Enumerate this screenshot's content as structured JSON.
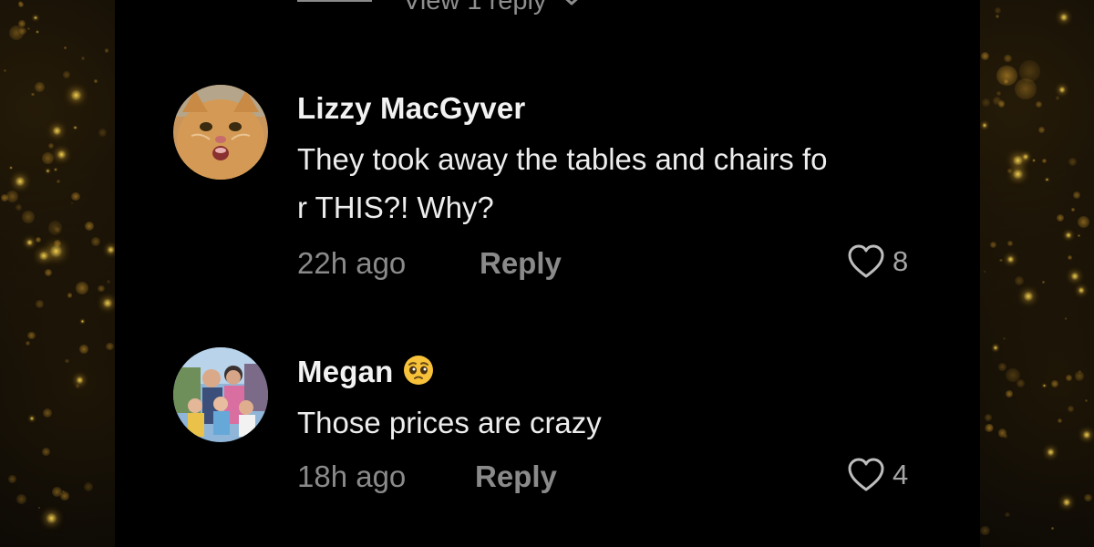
{
  "thread": {
    "view_replies_label": "View 1 reply"
  },
  "comments": [
    {
      "author": "Lizzy MacGyver",
      "text_line1": "They took away the tables and chairs fo",
      "text_line2": "r THIS?! Why?",
      "time": "22h ago",
      "reply_label": "Reply",
      "likes": "8",
      "avatar_icon": "cat-avatar"
    },
    {
      "author": "Megan",
      "author_emoji": "pleading-face-emoji",
      "text_line1": "Those prices are crazy",
      "time": "18h ago",
      "reply_label": "Reply",
      "likes": "4",
      "avatar_icon": "family-photo-avatar"
    }
  ],
  "colors": {
    "background": "#000000",
    "name": "#f2f2f2",
    "text": "#ededed",
    "muted": "#8a8a8a",
    "side_bokeh": "#f5c542"
  }
}
